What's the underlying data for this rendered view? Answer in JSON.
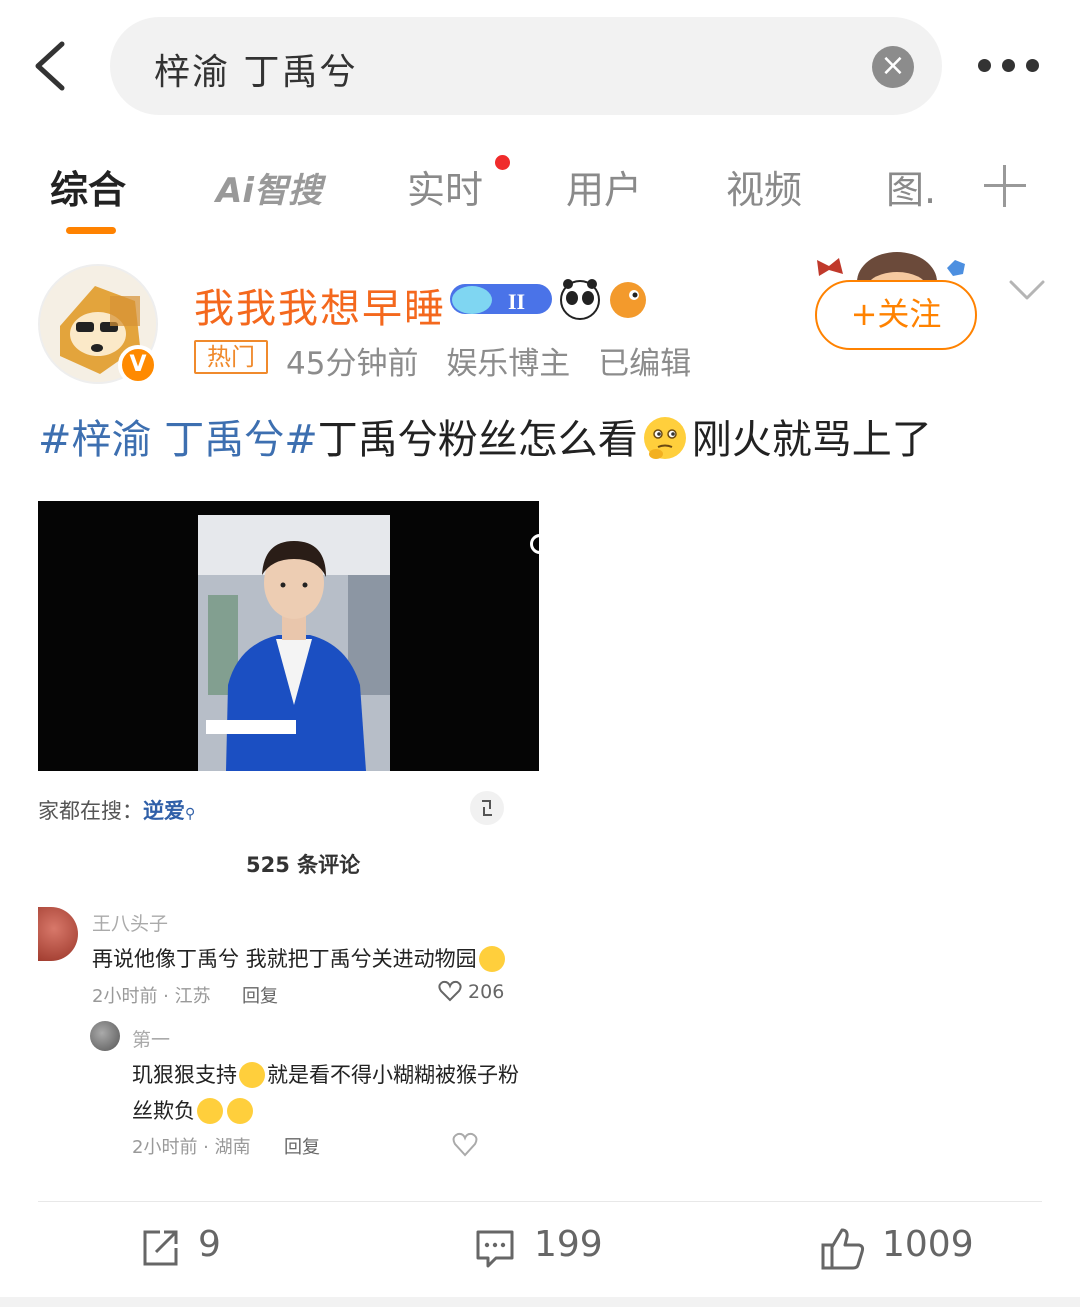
{
  "search": {
    "query": "梓渝 丁禹兮",
    "clear_icon": "×"
  },
  "tabs": [
    {
      "label": "综合",
      "active": true
    },
    {
      "label": "Ai智搜",
      "active": false
    },
    {
      "label": "实时",
      "active": false,
      "has_dot": true
    },
    {
      "label": "用户",
      "active": false
    },
    {
      "label": "视频",
      "active": false
    },
    {
      "label": "图.",
      "active": false
    }
  ],
  "post": {
    "username": "我我我想早睡",
    "verified_badge": "V",
    "hot_tag": "热门",
    "time": "45分钟前",
    "category": "娱乐博主",
    "edited": "已编辑",
    "follow_label": "+关注",
    "text": {
      "hashtag": "#梓渝 丁禹兮#",
      "part1": "丁禹兮粉丝怎么看",
      "part2": "刚火就骂上了"
    }
  },
  "embed": {
    "search_hint_prefix": "家都在搜：",
    "search_hint_term": "逆爱",
    "comment_count": "525 条评论",
    "comment1": {
      "name": "王八头子",
      "body": "再说他像丁禹兮 我就把丁禹兮关进动物园",
      "time_loc": "2小时前 · 江苏",
      "reply": "回复",
      "likes": "206"
    },
    "comment2": {
      "name": "第一",
      "body_line1": "玑狠狠支持",
      "body_line1b": "就是看不得小糊糊被猴子粉",
      "body_line2": "丝欺负",
      "time_loc": "2小时前 · 湖南",
      "reply": "回复"
    }
  },
  "actions": {
    "repost": "9",
    "comments": "199",
    "likes": "1009"
  },
  "colors": {
    "accent": "#ff8200",
    "username": "#f4681d",
    "hashtag": "#3d6fb0",
    "tab_dot": "#f02b2b"
  },
  "icons": [
    "back-arrow-icon",
    "clear-icon",
    "more-dots-icon",
    "plus-icon",
    "chevron-down-icon",
    "repost-icon",
    "comment-icon",
    "like-icon",
    "heart-icon",
    "expand-icon"
  ]
}
